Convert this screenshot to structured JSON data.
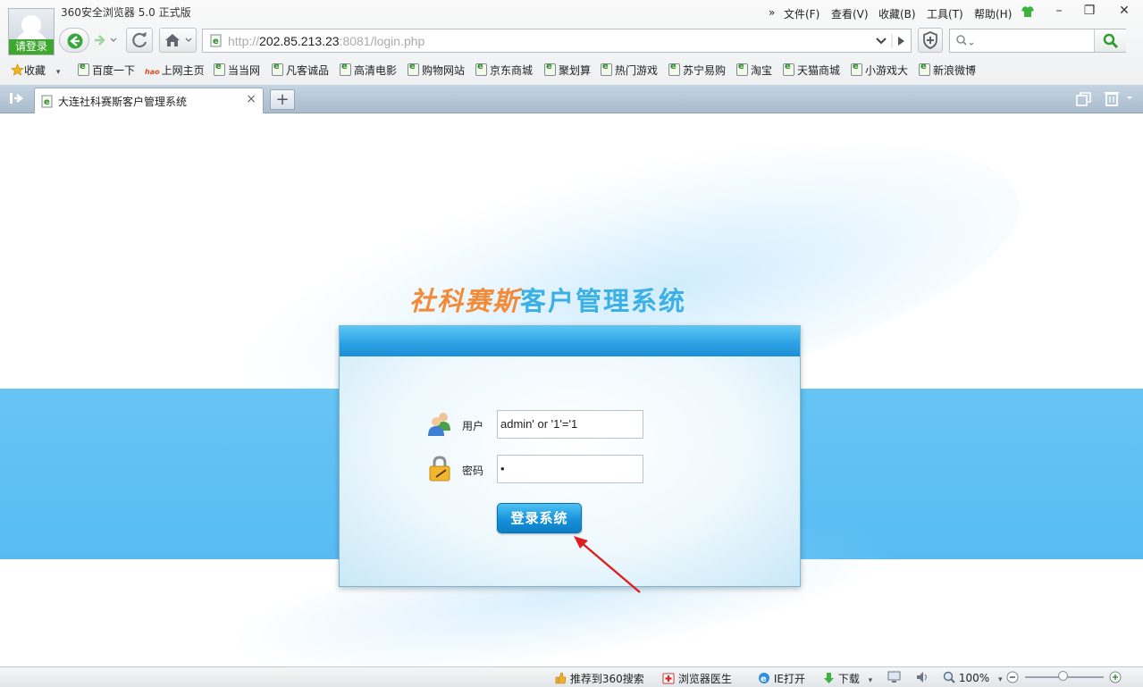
{
  "browser": {
    "title": "360安全浏览器 5.0 正式版",
    "login_label": "请登录",
    "menu": [
      "文件(F)",
      "查看(V)",
      "收藏(B)",
      "工具(T)",
      "帮助(H)"
    ],
    "menu_more": "»",
    "url_prefix": "http://",
    "url_host": "202.85.213.23",
    "url_rest": ":8081/login.php",
    "favorites_label": "收藏",
    "bookmarks": [
      "百度一下",
      "上网主页",
      "当当网",
      "凡客诚品",
      "高清电影",
      "购物网站",
      "京东商城",
      "聚划算",
      "热门游戏",
      "苏宁易购",
      "淘宝",
      "天猫商城",
      "小游戏大",
      "新浪微博"
    ],
    "tab_title": "大连社科赛斯客户管理系统",
    "tab_close": "×",
    "new_tab": "+"
  },
  "page": {
    "title_part1": "社科赛斯",
    "title_part2": "客户管理系统",
    "user_label": "用户",
    "user_value": "admin' or '1'='1",
    "password_label": "密码",
    "password_value": "•",
    "login_button": "登录系统"
  },
  "statusbar": {
    "recommend": "推荐到360搜索",
    "doctor": "浏览器医生",
    "ie_open": "IE打开",
    "download": "下载",
    "zoom": "100%"
  },
  "colors": {
    "title_orange": "#f28a38",
    "title_blue": "#3ab0e6",
    "band_blue": "#5ec0f4",
    "annotation_arrow": "#e02020"
  }
}
